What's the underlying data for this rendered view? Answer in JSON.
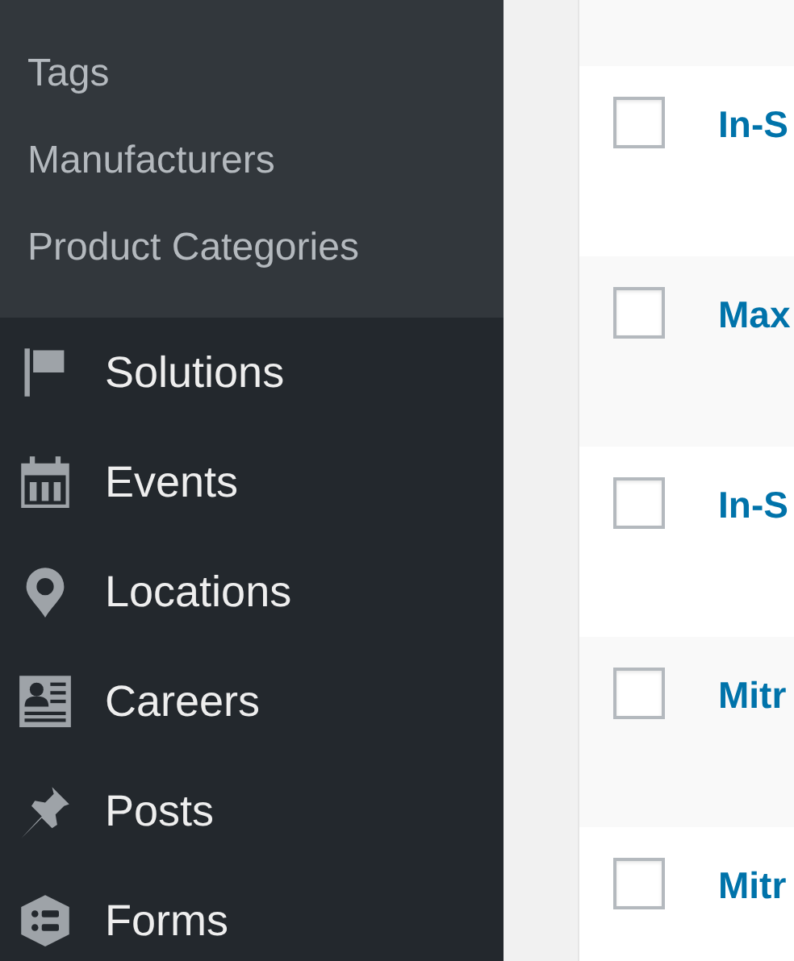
{
  "sidebar": {
    "submenu": [
      {
        "label": "Tags"
      },
      {
        "label": "Manufacturers"
      },
      {
        "label": "Product Categories"
      }
    ],
    "menu": [
      {
        "label": "Solutions"
      },
      {
        "label": "Events"
      },
      {
        "label": "Locations"
      },
      {
        "label": "Careers"
      },
      {
        "label": "Posts"
      },
      {
        "label": "Forms"
      }
    ]
  },
  "table": {
    "rows": [
      {
        "title": "In-S",
        "checked": false
      },
      {
        "title": "Max",
        "checked": false
      },
      {
        "title": "In-S",
        "checked": false
      },
      {
        "title": "Mitr",
        "checked": false
      },
      {
        "title": "Mitr",
        "checked": false
      }
    ]
  }
}
